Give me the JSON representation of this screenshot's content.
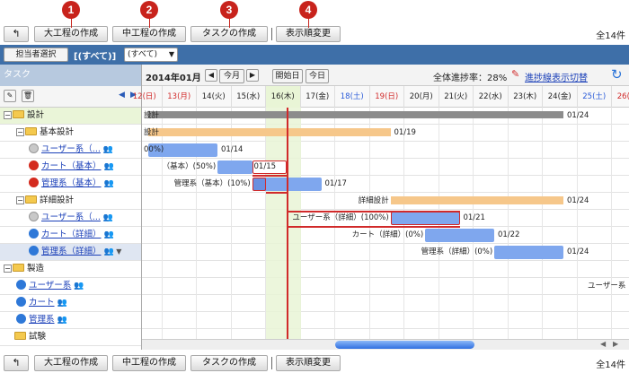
{
  "toolbar": {
    "back_icon": "back-arrow-icon",
    "create_major": "大工程の作成",
    "create_mid": "中工程の作成",
    "create_task": "タスクの作成",
    "change_order": "表示順変更",
    "count": "全14件"
  },
  "markers": [
    "1",
    "2",
    "3",
    "4"
  ],
  "filter": {
    "assignee_button": "担当者選択",
    "selected": "[(すべて)]",
    "dropdown": "(すべて)"
  },
  "left": {
    "header": "タスク",
    "rows": [
      {
        "label": "設計"
      },
      {
        "label": "基本設計"
      },
      {
        "label": "ユーザー系（..."
      },
      {
        "label": "カート（基本）"
      },
      {
        "label": "管理系（基本）"
      },
      {
        "label": "詳細設計"
      },
      {
        "label": "ユーザー系（..."
      },
      {
        "label": "カート（詳細）"
      },
      {
        "label": "管理系（詳細）"
      },
      {
        "label": "製造"
      },
      {
        "label": "ユーザー系"
      },
      {
        "label": "カート"
      },
      {
        "label": "管理系"
      },
      {
        "label": "試験"
      }
    ]
  },
  "gantt": {
    "month": "2014年01月",
    "this_month": "今月",
    "start_day": "開始日",
    "today": "今日",
    "progress_label": "全体進捗率：28%",
    "toggle_link": "進捗線表示切替",
    "days": [
      "12(日)",
      "13(月)",
      "14(火)",
      "15(水)",
      "16(木)",
      "17(金)",
      "18(土)",
      "19(日)",
      "20(月)",
      "21(火)",
      "22(水)",
      "23(木)",
      "24(金)",
      "25(土)",
      "26(日)"
    ],
    "labels": {
      "r0_left": "設計",
      "r0_end": "01/24",
      "r1_left": "設計",
      "r1_end": "01/19",
      "r2_left": "00%)",
      "r2_end": "01/14",
      "r3_left": "（基本）(50%)",
      "r3_end": "01/15",
      "r4_left": "管理系（基本）(10%)",
      "r4_end": "01/17",
      "r5_left": "詳細設計",
      "r5_end": "01/24",
      "r6_left": "ユーザー系（詳細）(100%)",
      "r6_end": "01/21",
      "r7_left": "カート（詳細）(0%)",
      "r7_end": "01/22",
      "r8_left": "管理系（詳細）(0%)",
      "r8_end": "01/24",
      "r10_left": "ユーザー系"
    }
  },
  "colors": {
    "accent_blue": "#3e6fa8",
    "summary_bar": "#8c8c8c",
    "orange_bar": "#f6c78a",
    "blue_bar": "#7fa7ee",
    "progress_line": "#d12a2a",
    "today_col": "#e9f5d6",
    "marker_red": "#c8231c"
  }
}
